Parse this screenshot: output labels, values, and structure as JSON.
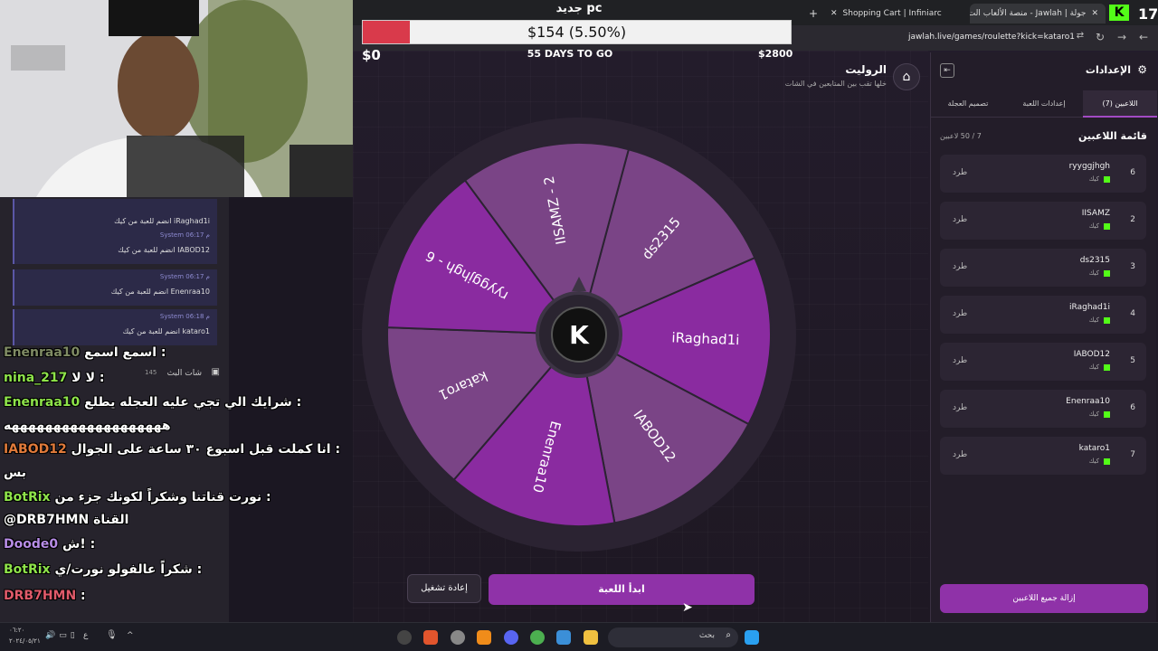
{
  "browser": {
    "tabs": [
      {
        "label": "جولة | Jawlah - منصة الألعاب الت"
      },
      {
        "label": "Shopping Cart | Infiniarc"
      }
    ],
    "url": "jawlah.live/games/roulette?kick=kataro1"
  },
  "overlay": {
    "title": "جديد pc",
    "progress_text": "$154 (5.50%)",
    "progress_percent": 5.5,
    "min_label": "$0",
    "days_label": "55 DAYS TO GO",
    "max_label": "$2800",
    "kick_viewers": "17"
  },
  "game": {
    "title": "الروليت",
    "subtitle": "خلها تقب بين المتابعين في الشات",
    "wheel_segments": [
      "ds2315",
      "iRaghad1i",
      "IABOD12",
      "Enenraa10",
      "kataro1",
      "ryyggjhgh - 6",
      "IISAMZ - 2"
    ],
    "reset_button": "إعادة تشغيل",
    "start_button": "ابدأ اللعبة"
  },
  "settings": {
    "title": "الإعدادات",
    "tabs": [
      "اللاعبين (7)",
      "إعدادات اللعبة",
      "تصميم العجلة"
    ],
    "list_title": "قائمة اللاعبين",
    "count": "7 / 50 لاعبين",
    "players": [
      {
        "num": "6",
        "name": "ryyggjhgh",
        "platform": "كيك",
        "action": "طرد"
      },
      {
        "num": "2",
        "name": "IISAMZ",
        "platform": "كيك",
        "action": "طرد"
      },
      {
        "num": "3",
        "name": "ds2315",
        "platform": "كيك",
        "action": "طرد"
      },
      {
        "num": "4",
        "name": "iRaghad1i",
        "platform": "كيك",
        "action": "طرد"
      },
      {
        "num": "5",
        "name": "IABOD12",
        "platform": "كيك",
        "action": "طرد"
      },
      {
        "num": "6",
        "name": "Enenraa10",
        "platform": "كيك",
        "action": "طرد"
      },
      {
        "num": "7",
        "name": "kataro1",
        "platform": "كيك",
        "action": "طرد"
      }
    ],
    "remove_all": "إزالة جميع اللاعبين"
  },
  "chat": {
    "system_messages": [
      {
        "meta": "",
        "text": "iRaghad1i انضم للعبة من كيك"
      },
      {
        "meta": "System 06:17 م",
        "text": "IABOD12 انضم للعبة من كيك"
      },
      {
        "meta": "System 06:17 م",
        "text": "Enenraa10 انضم للعبة من كيك"
      },
      {
        "meta": "System 06:18 م",
        "text": "kataro1 انضم للعبة من كيك"
      }
    ],
    "header": "شات البث",
    "header_count": "145",
    "overlay_lines": [
      {
        "user": "Enenraa10",
        "text": "اسمع اسمع :",
        "color": "#7f8b64"
      },
      {
        "user": "nina_217",
        "text": "لا لا :",
        "color": "#8ee34a"
      },
      {
        "user": "Enenraa10",
        "text": "شرايك الي تجي عليه العجله يطلع :",
        "color": "#8ee34a"
      },
      {
        "user": "",
        "text": "هههههههههههههههههههه",
        "color": "#fff"
      },
      {
        "user": "IABOD12",
        "text": "انا كملت قبل اسبوع ٣٠ ساعة على الجوال :",
        "color": "#e07a3a"
      },
      {
        "user": "",
        "text": "بس",
        "color": "#fff"
      },
      {
        "user": "BotRix",
        "text": "نورت قناتنا وشكراً لكونك جزء من :",
        "color": "#8ee34a"
      },
      {
        "user": "",
        "text": "@DRB7HMN القناة",
        "color": "#fff"
      },
      {
        "user": "Doode0",
        "text": "ش! :",
        "color": "#b78ce6"
      },
      {
        "user": "BotRix",
        "text": "شكراً عالفولو نورت/ي :",
        "color": "#8ee34a"
      },
      {
        "user": "DRB7HMN",
        "text": ":",
        "color": "#e05a6a"
      }
    ]
  },
  "taskbar": {
    "search_placeholder": "بحث",
    "time": "٠٦:٢٠",
    "date": "٢٠٢٤/٠٥/٢١"
  }
}
